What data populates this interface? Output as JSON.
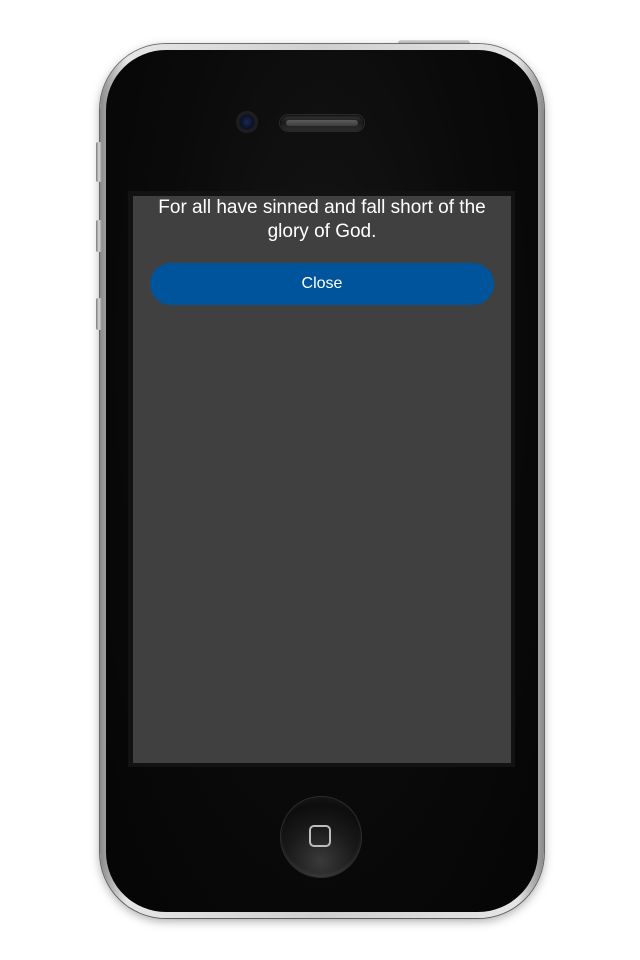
{
  "dialog": {
    "message": "For all have sinned and fall short of the glory of God.",
    "close_label": "Close"
  },
  "device": {
    "body_color": "#0a0a0a",
    "screen_color": "#404040",
    "button_color": "#00549b"
  },
  "icons": {
    "camera": "camera-icon",
    "speaker": "speaker-grille",
    "home": "home-button-icon"
  }
}
